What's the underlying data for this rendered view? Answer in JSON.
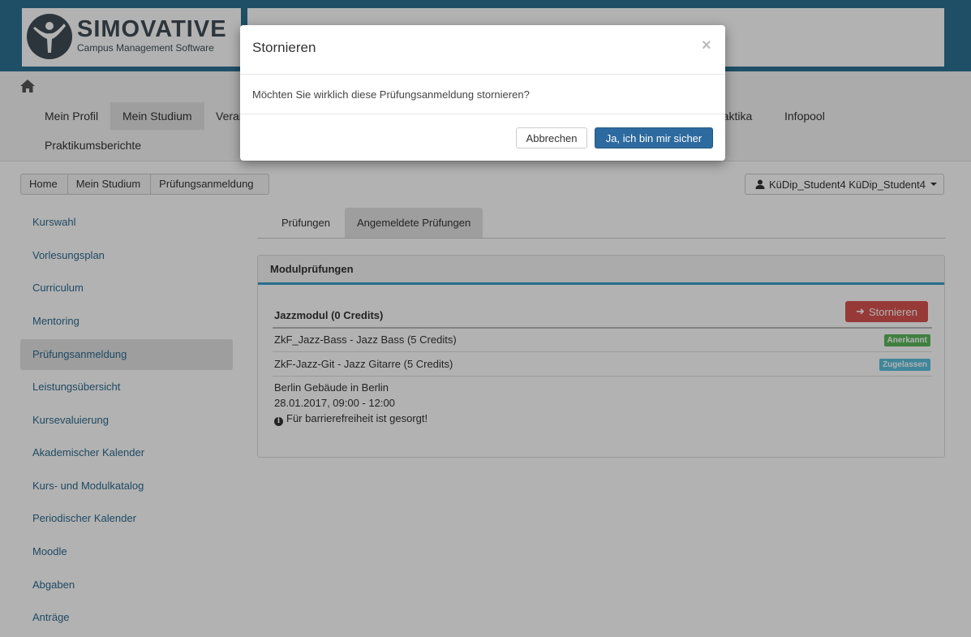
{
  "brand": {
    "title": "SIMOVATIVE",
    "subtitle": "Campus Management Software"
  },
  "nav": {
    "row1": [
      "Mein Profil",
      "Mein Studium",
      "Veran",
      "raktika",
      "Infopool"
    ],
    "row2": [
      "Praktikumsberichte"
    ]
  },
  "breadcrumb": [
    "Home",
    "Mein Studium",
    "Prüfungsanmeldung"
  ],
  "user": {
    "label": "KüDip_Student4 KüDip_Student4"
  },
  "sidebar": {
    "items": [
      "Kurswahl",
      "Vorlesungsplan",
      "Curriculum",
      "Mentoring",
      "Prüfungsanmeldung",
      "Leistungsübersicht",
      "Kursevaluierung",
      "Akademischer Kalender",
      "Kurs- und Modulkatalog",
      "Periodischer Kalender",
      "Moodle",
      "Abgaben",
      "Anträge"
    ],
    "active_index": 4
  },
  "tabs": [
    "Prüfungen",
    "Angemeldete Prüfungen"
  ],
  "panel": {
    "title": "Modulprüfungen",
    "module": "Jazzmodul (0 Credits)",
    "cancel_button": "Stornieren",
    "rows": [
      {
        "name": "ZkF_Jazz-Bass - Jazz Bass (5 Credits)",
        "badge": "Anerkannt"
      },
      {
        "name": "ZkF-Jazz-Git - Jazz Gitarre (5 Credits)",
        "badge": "Zugelassen"
      }
    ],
    "location": "Berlin Gebäude in Berlin",
    "datetime": "28.01.2017, 09:00 - 12:00",
    "note": "Für barrierefreiheit ist gesorgt!"
  },
  "modal": {
    "title": "Stornieren",
    "close": "×",
    "body": "Möchten Sie wirklich diese Prüfungsanmeldung stornieren?",
    "cancel": "Abbrechen",
    "confirm": "Ja, ich bin mir sicher"
  },
  "colors": {
    "header": "#2d7194",
    "primary": "#2d6a9f",
    "danger": "#d9534f",
    "success": "#5cb85c",
    "info": "#5bc0de"
  }
}
